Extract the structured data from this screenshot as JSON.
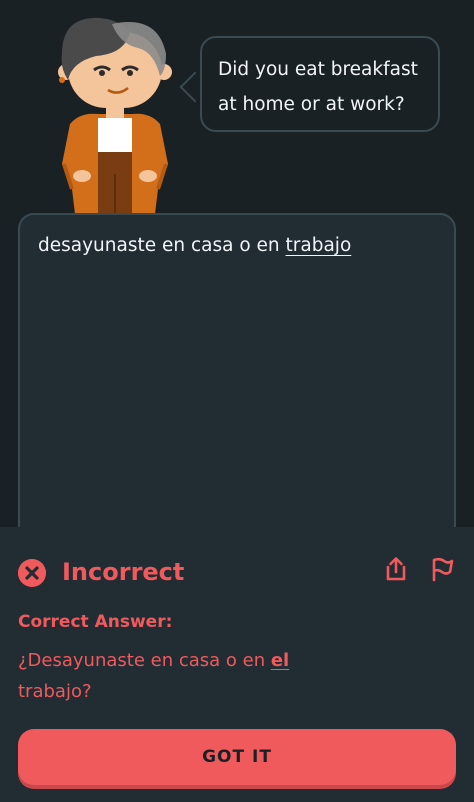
{
  "prompt": {
    "speech_line1": "Did you eat breakfast",
    "speech_line2": "at home or at work?"
  },
  "answer": {
    "text_prefix": "desayunaste en casa o en ",
    "text_underlined": "trabajo"
  },
  "feedback": {
    "status": "Incorrect",
    "correct_label": "Correct Answer:",
    "correct_prefix": "¿Desayunaste en casa o en ",
    "correct_highlight": "el",
    "correct_suffix": "trabajo?"
  },
  "actions": {
    "got_it": "GOT IT"
  },
  "colors": {
    "background": "#1a2125",
    "panel": "#212c33",
    "error": "#f05a5d",
    "border": "#3a4a52",
    "text": "#f1f5f7",
    "character_jacket": "#d36e1a"
  },
  "icons": {
    "status": "close-circle-icon",
    "share": "share-icon",
    "flag": "flag-icon"
  }
}
